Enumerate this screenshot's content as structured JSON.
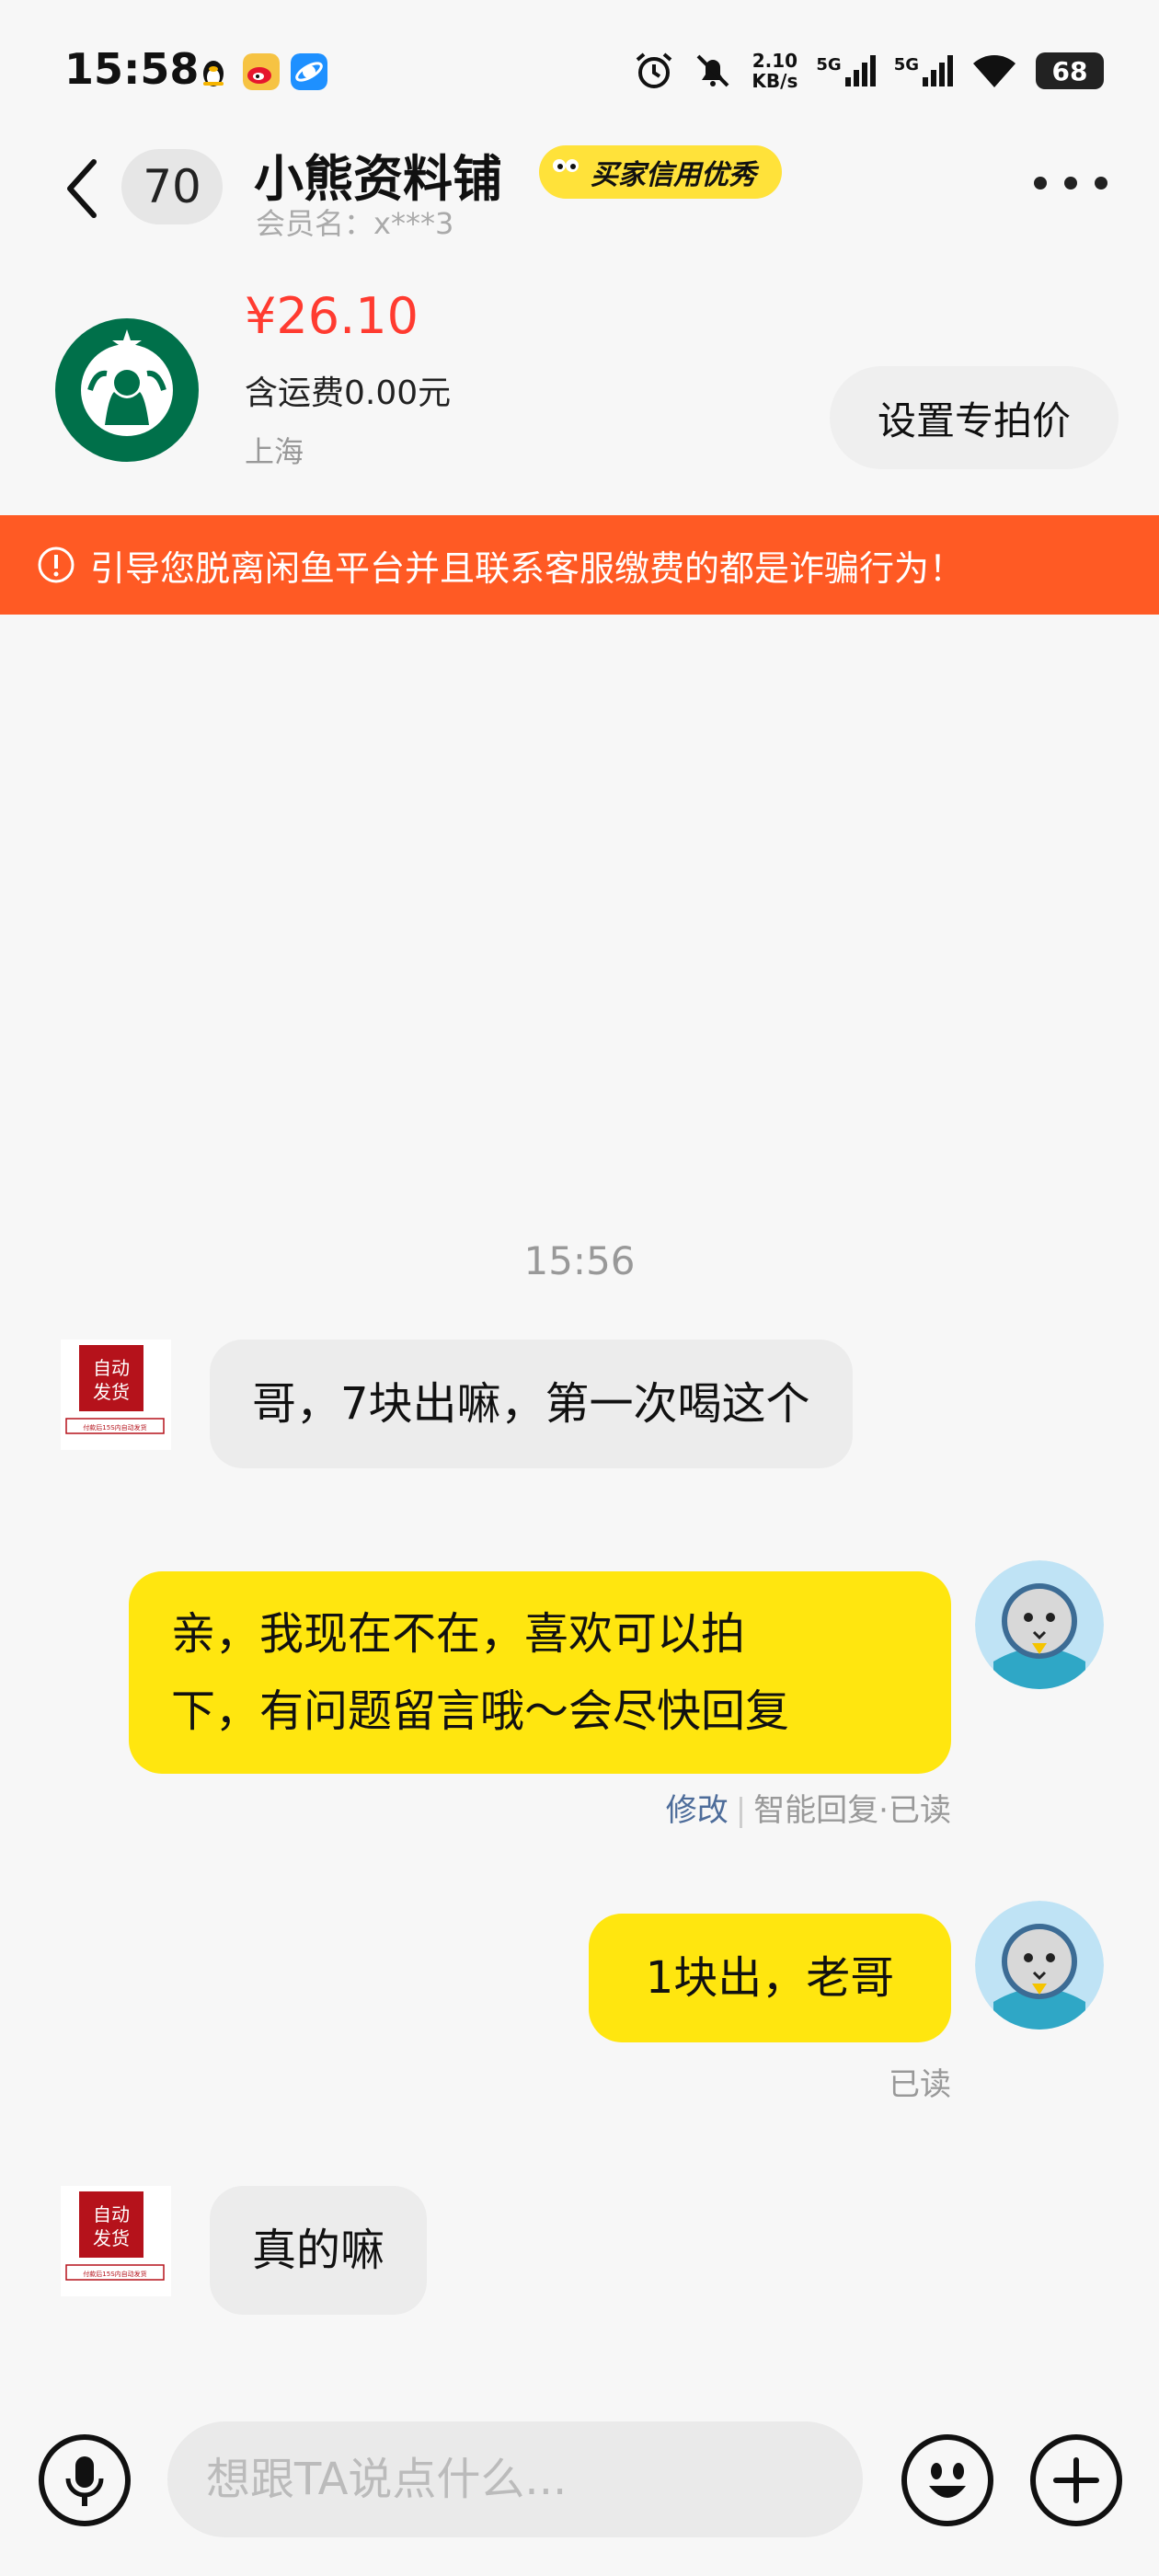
{
  "status_bar": {
    "time": "15:58",
    "speed": "2.10",
    "speed_unit": "KB/s",
    "net1": "5G",
    "net2": "5G",
    "battery": "68",
    "icons": [
      "penguin-icon",
      "weibo-icon",
      "browser-icon",
      "alarm-icon",
      "mute-icon",
      "wifi-icon"
    ]
  },
  "header": {
    "unread_count": "70",
    "shop_name": "小熊资料铺",
    "credit_badge": "买家信用优秀",
    "member_label": "会员名：x***3"
  },
  "product": {
    "price": "¥26.10",
    "shipping": "含运费0.00元",
    "location": "上海",
    "special_price_button": "设置专拍价"
  },
  "warning": {
    "text": "引导您脱离闲鱼平台并且联系客服缴费的都是诈骗行为！",
    "color": "#ff5a24"
  },
  "chat": {
    "timestamp": "15:56",
    "seller_avatar": {
      "line1": "自动",
      "line2": "发货",
      "caption": "付款后15S内自动发货"
    },
    "messages": [
      {
        "from": "other",
        "text": "哥，7块出嘛，第一次喝这个"
      },
      {
        "from": "me",
        "lines": [
          "亲，我现在不在，喜欢可以拍",
          "下，有问题留言哦～会尽快回复"
        ],
        "meta_edit": "修改",
        "meta_status": "智能回复·已读"
      },
      {
        "from": "me",
        "text": "1块出，老哥",
        "meta_status": "已读"
      },
      {
        "from": "other",
        "text": "真的嘛"
      }
    ]
  },
  "input": {
    "placeholder": "想跟TA说点什么..."
  },
  "colors": {
    "accent_yellow": "#ffe60f",
    "price_red": "#ff3b30",
    "warning_orange": "#ff5a24"
  }
}
